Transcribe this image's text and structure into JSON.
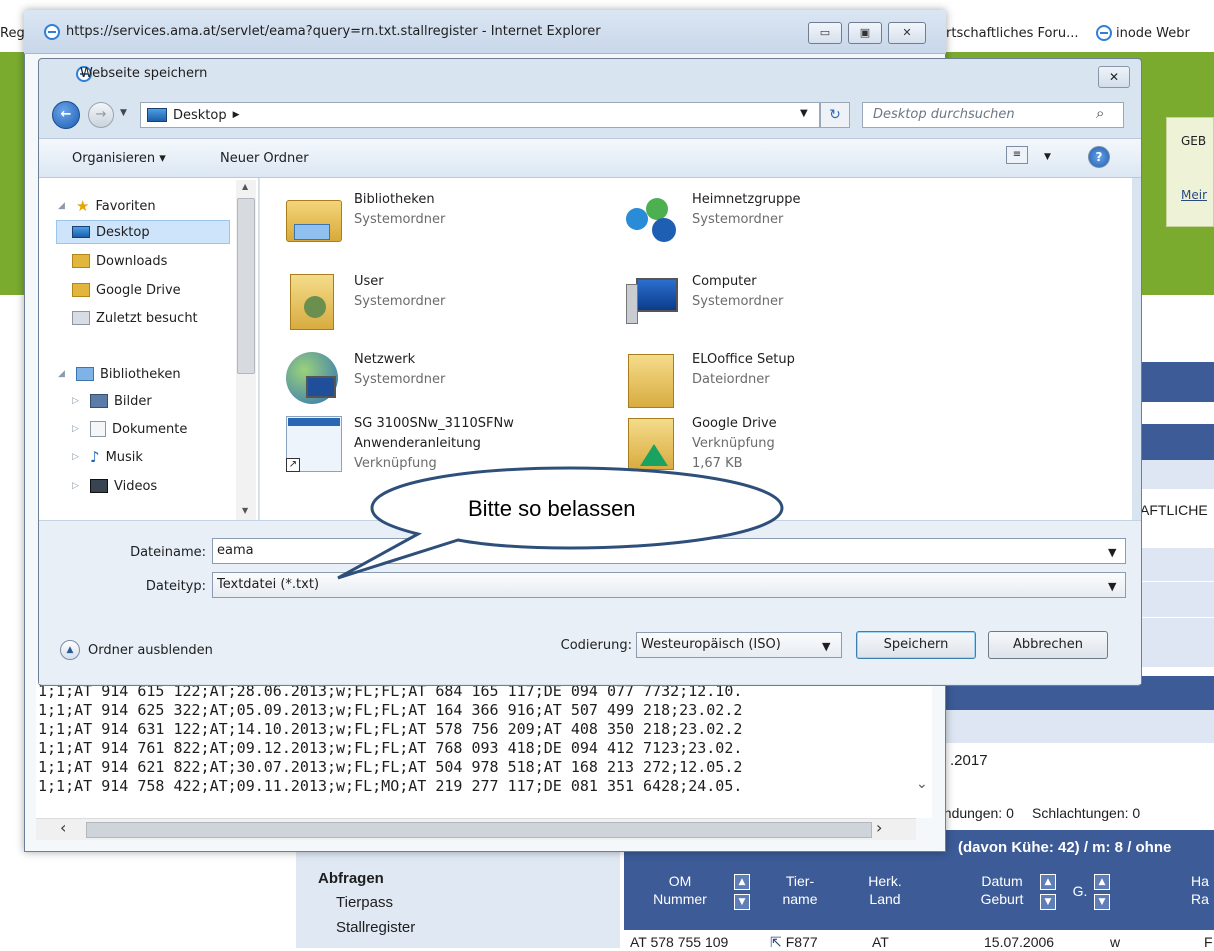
{
  "background_page": {
    "left_partial": "Reg",
    "tab_forum": "rtschaftliches Foru...",
    "tab_inode": "inode Webr",
    "greenbox_line1": "GEB",
    "greenbox_line2": "Meir",
    "aftliche": "AFTLICHE",
    "date_partial": ".2017",
    "tab_sendungen": "endungen: 0",
    "tab_schlachtungen": "Schlachtungen: 0",
    "herd_summary": "(davon Kühe: 42) / m: 8 / ohne",
    "nav_heading": "Abfragen",
    "nav_items": [
      "Tierpass",
      "Stallregister"
    ],
    "table_headers": [
      {
        "line1": "OM",
        "line2": "Nummer"
      },
      {
        "line1": "Tier-",
        "line2": "name"
      },
      {
        "line1": "Herk.",
        "line2": "Land"
      },
      {
        "line1": "Datum",
        "line2": "Geburt"
      },
      {
        "line1": "G.",
        "line2": ""
      },
      {
        "line1": "Ha",
        "line2": "Ra"
      }
    ],
    "row1": [
      "AT 578 755 109",
      "F877",
      "AT",
      "15.07.2006",
      "w",
      "F"
    ]
  },
  "ie_window": {
    "title": "https://services.ama.at/servlet/eama?query=rn.txt.stallregister - Internet Explorer",
    "minimize": "▭",
    "maximize": "▣",
    "close": "✕",
    "text_lines": [
      "1;1;AT 914 615 122;AT;28.06.2013;w;FL;FL;AT 684 165 117;DE 094 077 7732;12.10.",
      "1;1;AT 914 625 322;AT;05.09.2013;w;FL;FL;AT 164 366 916;AT 507 499 218;23.02.2",
      "1;1;AT 914 631 122;AT;14.10.2013;w;FL;FL;AT 578 756 209;AT 408 350 218;23.02.2",
      "1;1;AT 914 761 822;AT;09.12.2013;w;FL;FL;AT 768 093 418;DE 094 412 7123;23.02.",
      "1;1;AT 914 621 822;AT;30.07.2013;w;FL;FL;AT 504 978 518;AT 168 213 272;12.05.2",
      "1;1;AT 914 758 422;AT;09.11.2013;w;FL;MO;AT 219 277 117;DE 081 351 6428;24.05."
    ]
  },
  "save_dialog": {
    "title": "Webseite speichern",
    "close": "✕",
    "address_path": "Desktop",
    "search_placeholder": "Desktop durchsuchen",
    "toolbar": {
      "organize": "Organisieren ▾",
      "new_folder": "Neuer Ordner"
    },
    "nav": {
      "favorites": "Favoriten",
      "favorites_items": [
        "Desktop",
        "Downloads",
        "Google Drive",
        "Zuletzt besucht"
      ],
      "libraries": "Bibliotheken",
      "library_items": [
        "Bilder",
        "Dokumente",
        "Musik",
        "Videos"
      ]
    },
    "files": [
      {
        "name": "Bibliotheken",
        "sub": "Systemordner",
        "sub2": "",
        "icon": "libraries-icon"
      },
      {
        "name": "Heimnetzgruppe",
        "sub": "Systemordner",
        "sub2": "",
        "icon": "homegroup-icon"
      },
      {
        "name": "User",
        "sub": "Systemordner",
        "sub2": "",
        "icon": "user-folder-icon"
      },
      {
        "name": "Computer",
        "sub": "Systemordner",
        "sub2": "",
        "icon": "computer-icon"
      },
      {
        "name": "Netzwerk",
        "sub": "Systemordner",
        "sub2": "",
        "icon": "network-icon"
      },
      {
        "name": "ELOoffice Setup",
        "sub": "Dateiordner",
        "sub2": "",
        "icon": "folder-icon"
      },
      {
        "name": "SG 3100SNw_3110SFNw",
        "sub": "Anwenderanleitung",
        "sub2": "Verknüpfung",
        "icon": "shortcut-doc-icon"
      },
      {
        "name": "Google Drive",
        "sub": "Verknüpfung",
        "sub2": "1,67 KB",
        "icon": "google-drive-icon"
      }
    ],
    "filename_label": "Dateiname:",
    "filename_value": "eama",
    "filetype_label": "Dateityp:",
    "filetype_value": "Textdatei (*.txt)",
    "hide_folders": "Ordner ausblenden",
    "encoding_label": "Codierung:",
    "encoding_value": "Westeuropäisch (ISO)",
    "save": "Speichern",
    "cancel": "Abbrechen"
  },
  "callout": {
    "text": "Bitte so belassen"
  },
  "colors": {
    "green": "#7aab2f",
    "navy": "#3c5b97",
    "selection": "#cde4fb"
  }
}
